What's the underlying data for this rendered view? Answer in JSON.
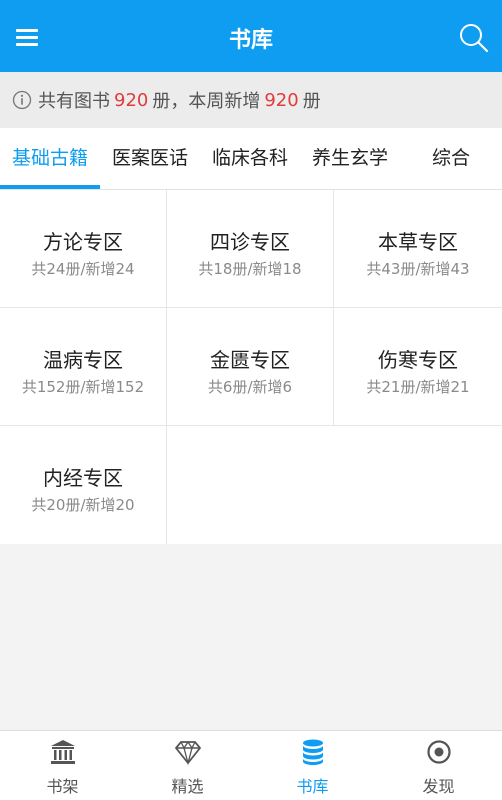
{
  "header": {
    "title": "书库",
    "menu_icon": "menu-icon",
    "search_icon": "search-icon"
  },
  "info": {
    "icon": "info-icon",
    "prefix": "共有图书",
    "total": "920",
    "middle": "册，本周新增",
    "new_count": "920",
    "suffix": "册"
  },
  "tabs": [
    {
      "label": "基础古籍",
      "active": true
    },
    {
      "label": "医案医话"
    },
    {
      "label": "临床各科"
    },
    {
      "label": "养生玄学"
    },
    {
      "label": "综合"
    }
  ],
  "sections": [
    {
      "title": "方论专区",
      "sub": "共24册/新增24"
    },
    {
      "title": "四诊专区",
      "sub": "共18册/新增18"
    },
    {
      "title": "本草专区",
      "sub": "共43册/新增43"
    },
    {
      "title": "温病专区",
      "sub": "共152册/新增152"
    },
    {
      "title": "金匮专区",
      "sub": "共6册/新增6"
    },
    {
      "title": "伤寒专区",
      "sub": "共21册/新增21"
    },
    {
      "title": "内经专区",
      "sub": "共20册/新增20"
    }
  ],
  "bottom_nav": [
    {
      "label": "书架",
      "icon": "bookshelf-icon"
    },
    {
      "label": "精选",
      "icon": "diamond-icon"
    },
    {
      "label": "书库",
      "icon": "database-icon",
      "active": true
    },
    {
      "label": "发现",
      "icon": "discover-icon"
    }
  ],
  "colors": {
    "primary": "#0e9df0",
    "highlight": "#e23b3b",
    "background": "#f3f3f3"
  }
}
